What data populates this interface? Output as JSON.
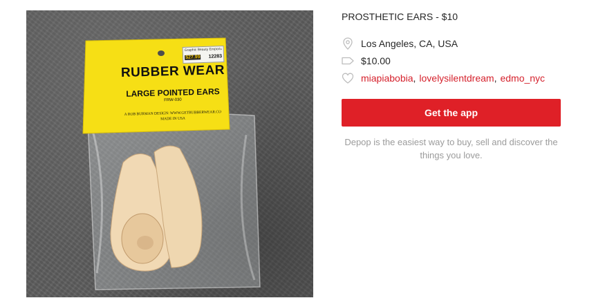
{
  "product": {
    "title": "PROSTHETIC EARS - $10",
    "location": "Los Angeles, CA, USA",
    "price": "$10.00",
    "likes": [
      "miapiabobia",
      "lovelysilentdream",
      "edmo_nyc"
    ],
    "like_separator": ","
  },
  "photo": {
    "package_title": "RUBBER WEAR",
    "package_subtitle": "LARGE POINTED EARS",
    "package_code": "FRW-030",
    "package_credit_line1": "A ROB BURMAN DESIGN: WWW.GETRUBBERWEAR.CO",
    "package_credit_line2": "MADE IN USA",
    "sticker_top": "Graphic Beauty Emporium",
    "sticker_price": "$27.99",
    "sticker_number": "12283"
  },
  "cta": {
    "label": "Get the app"
  },
  "tagline": "Depop is the easiest way to buy, sell and discover the things you love.",
  "icons": {
    "location": "location-pin-icon",
    "price": "price-tag-icon",
    "likes": "heart-icon"
  },
  "colors": {
    "accent": "#df2027",
    "link": "#d5212c",
    "muted_text": "#9b9b9b",
    "icon": "#bdbdbd"
  }
}
